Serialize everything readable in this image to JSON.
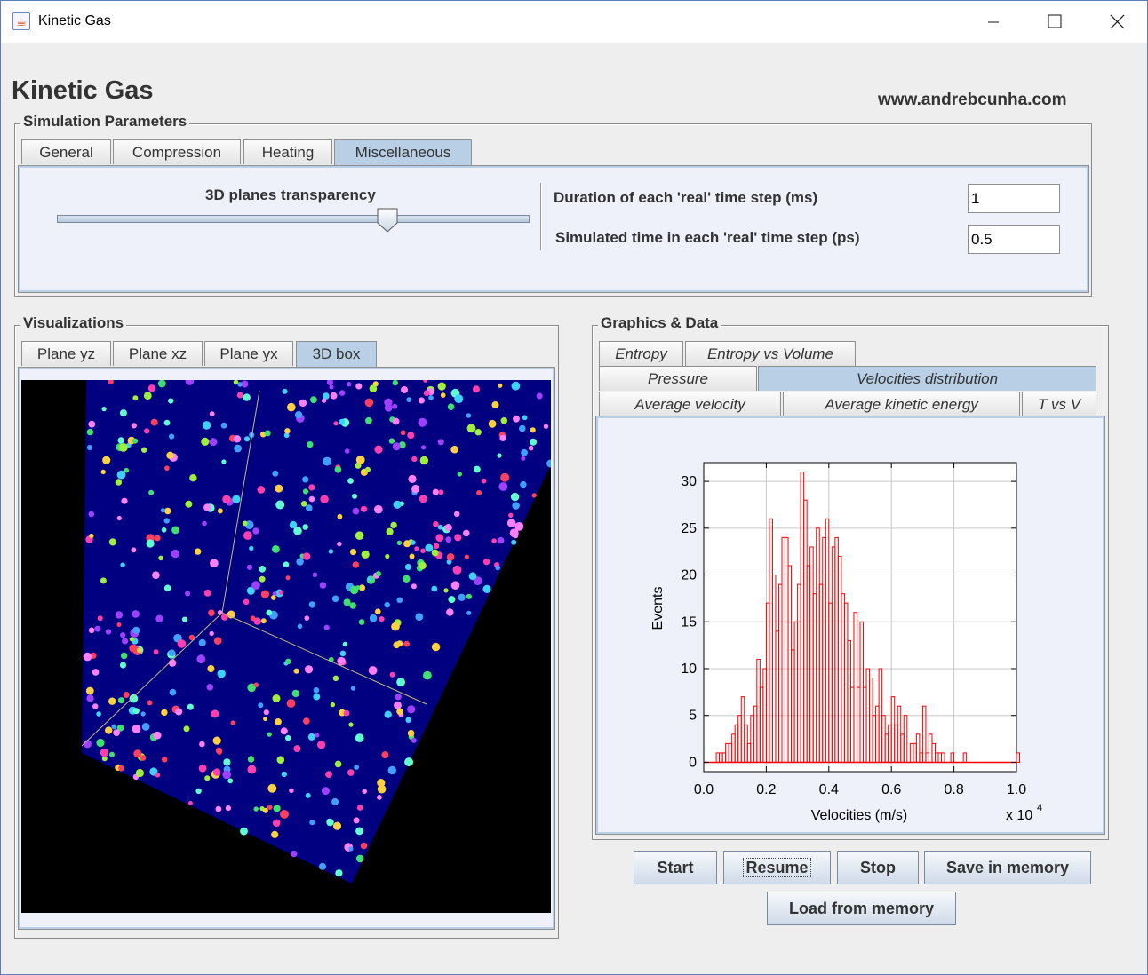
{
  "window": {
    "title": "Kinetic Gas",
    "minimize_glyph": "—",
    "maximize_glyph": "☐",
    "close_glyph": "✕",
    "app_icon": "java-icon"
  },
  "header": {
    "title": "Kinetic Gas",
    "website": "www.andrebcunha.com"
  },
  "simulation": {
    "group_title": "Simulation Parameters",
    "tabs": [
      "General",
      "Compression",
      "Heating",
      "Miscellaneous"
    ],
    "active_tab": "Miscellaneous",
    "transparency_label": "3D planes transparency",
    "transparency_value": 0.7,
    "duration_label": "Duration of each 'real' time step  (ms)",
    "duration_value": "1",
    "simtime_label": "Simulated time in each 'real' time step (ps)",
    "simtime_value": "0.5"
  },
  "visualizations": {
    "group_title": "Visualizations",
    "tabs": [
      "Plane yz",
      "Plane xz",
      "Plane yx",
      "3D box"
    ],
    "active_tab": "3D box",
    "box_color": "#000080",
    "axis_color": "#c8b878"
  },
  "graphics": {
    "group_title": "Graphics & Data",
    "tabs_row1": [
      "Entropy",
      "Entropy vs Volume"
    ],
    "tabs_row2": [
      "Pressure",
      "Velocities distribution"
    ],
    "tabs_row3": [
      "Average velocity",
      "Average kinetic energy",
      "T vs V"
    ],
    "active_tab": "Velocities distribution"
  },
  "buttons": {
    "start": "Start",
    "resume": "Resume",
    "stop": "Stop",
    "save": "Save in memory",
    "load": "Load from memory"
  },
  "chart_data": {
    "type": "bar",
    "xlabel": "Velocities (m/s)",
    "ylabel": "Events",
    "x_multiplier": "x 10",
    "x_multiplier_exponent": "4",
    "xlim": [
      0,
      1.0
    ],
    "ylim": [
      -1,
      32
    ],
    "x_ticks": [
      "0.0",
      "0.2",
      "0.4",
      "0.6",
      "0.8",
      "1.0"
    ],
    "y_ticks": [
      "0",
      "5",
      "10",
      "15",
      "20",
      "25",
      "30"
    ],
    "grid": true,
    "bar_color": "#ff0000",
    "bin_width": 0.01,
    "bin_start": 0.0,
    "values": [
      0,
      0,
      0,
      0,
      1,
      1,
      1,
      2,
      2,
      3,
      4,
      5,
      7,
      4,
      2,
      5,
      6,
      11,
      8,
      10,
      17,
      26,
      20,
      14,
      19,
      24,
      24,
      21,
      12,
      15,
      19,
      31,
      28,
      21,
      23,
      18,
      25,
      19,
      24,
      26,
      17,
      23,
      24,
      22,
      18,
      17,
      13,
      8,
      16,
      8,
      15,
      8,
      10,
      9,
      5,
      6,
      10,
      5,
      3,
      4,
      7,
      4,
      6,
      3,
      5,
      0,
      2,
      2,
      3,
      1,
      6,
      1,
      3,
      2,
      1,
      1,
      1,
      0,
      0,
      1,
      0,
      0,
      0,
      1,
      0,
      0,
      0,
      0,
      0,
      0,
      0,
      0,
      0,
      0,
      0,
      0,
      0,
      0,
      0,
      0,
      1
    ]
  }
}
